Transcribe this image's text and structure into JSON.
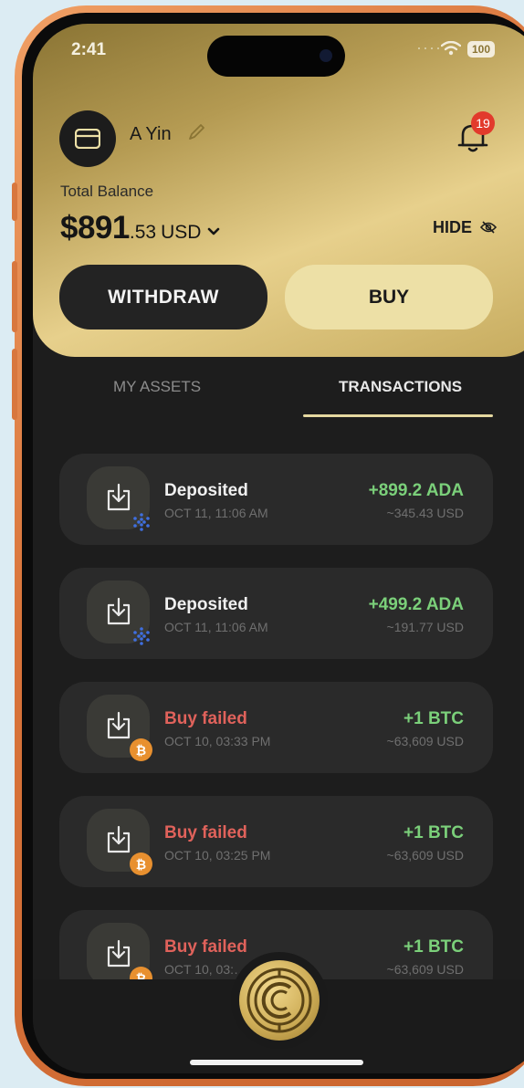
{
  "status_bar": {
    "time": "2:41",
    "battery": "100"
  },
  "profile": {
    "name": "A Yin",
    "notifications": "19"
  },
  "balance": {
    "label": "Total Balance",
    "main": "$891",
    "decimals": ".53",
    "currency": "USD",
    "hide_label": "HIDE"
  },
  "actions": {
    "withdraw": "WITHDRAW",
    "buy": "BUY"
  },
  "tabs": {
    "assets": "MY ASSETS",
    "transactions": "TRANSACTIONS",
    "active": "TRANSACTIONS"
  },
  "transactions": [
    {
      "title": "Deposited",
      "date": "OCT 11, 11:06 AM",
      "amount": "+899.2 ADA",
      "usd": "~345.43 USD",
      "status": "success",
      "coin": "ada-icon"
    },
    {
      "title": "Deposited",
      "date": "OCT 11, 11:06 AM",
      "amount": "+499.2 ADA",
      "usd": "~191.77 USD",
      "status": "success",
      "coin": "ada-icon"
    },
    {
      "title": "Buy failed",
      "date": "OCT 10, 03:33 PM",
      "amount": "+1 BTC",
      "usd": "~63,609 USD",
      "status": "failed",
      "coin": "btc-icon"
    },
    {
      "title": "Buy failed",
      "date": "OCT 10, 03:25 PM",
      "amount": "+1 BTC",
      "usd": "~63,609 USD",
      "status": "failed",
      "coin": "btc-icon"
    },
    {
      "title": "Buy failed",
      "date": "OCT 10, 03:…",
      "amount": "+1 BTC",
      "usd": "~63,609 USD",
      "status": "failed",
      "coin": "btc-icon"
    }
  ],
  "colors": {
    "gold_light": "#ede0a6",
    "gold_dark": "#8a7434",
    "positive": "#7bd07a",
    "failed": "#e0625b",
    "card_bg": "#2a2a2a",
    "frame": "#d8733a"
  },
  "icons": {
    "avatar": "wallet-icon",
    "edit": "pencil-icon",
    "notifications": "bell-icon",
    "hide": "eye-off-icon",
    "transaction": "download-icon",
    "home_logo": "coin-logo-icon"
  }
}
